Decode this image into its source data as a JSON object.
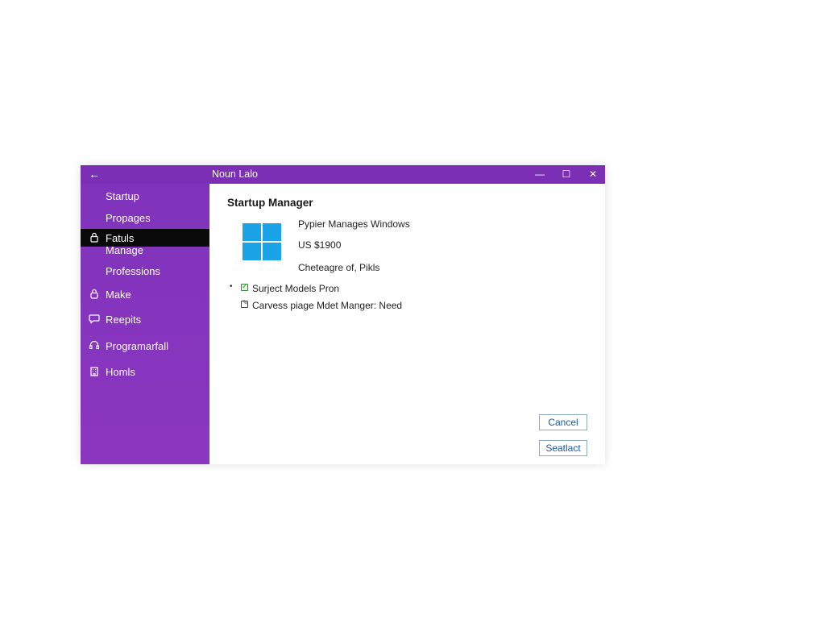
{
  "window": {
    "title": "Noun Lalo",
    "back_icon": "arrow-left-icon",
    "controls": {
      "minimize": "—",
      "maximize": "☐",
      "close": "✕"
    }
  },
  "sidebar": {
    "items": [
      {
        "label": "Startup",
        "icon": ""
      },
      {
        "label": "Propages",
        "icon": ""
      },
      {
        "label": "Fatuls",
        "icon": "lock-icon",
        "selected": true,
        "sub_label": "Manage"
      },
      {
        "label": "Professions",
        "icon": ""
      },
      {
        "label": "Make",
        "icon": "lock-icon"
      },
      {
        "label": "Reepits",
        "icon": "chat-icon"
      },
      {
        "label": "Programarfall",
        "icon": "headset-icon"
      },
      {
        "label": "Homls",
        "icon": "building-icon"
      }
    ]
  },
  "main": {
    "title": "Startup Manager",
    "info": {
      "line1": "Pypier Manages Windows",
      "line2": "US $1900",
      "line3": "Cheteagre of, Pikls"
    },
    "options": [
      {
        "label": "Surject Models Pron",
        "checked": true
      },
      {
        "label": "Carvess piage Mdet Manger: Need",
        "checked": false
      }
    ],
    "buttons": {
      "cancel": "Cancel",
      "secondary": "Seatlact"
    }
  },
  "colors": {
    "accent": "#7b2fb5",
    "selected": "#0a0a0a",
    "logo": "#1aa3e8",
    "button_text": "#1a5aa0",
    "check": "#2e8b2e"
  }
}
